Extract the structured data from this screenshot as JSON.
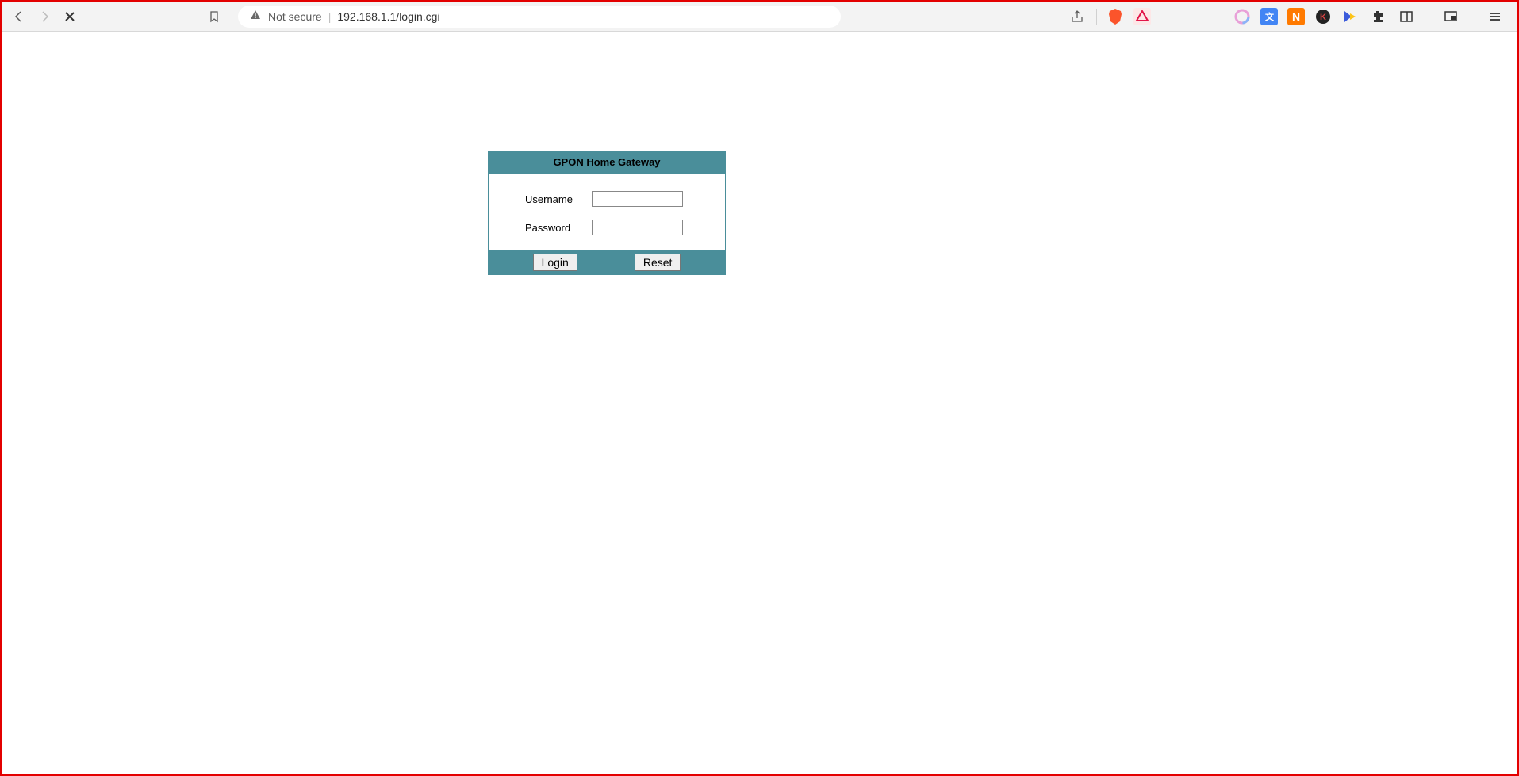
{
  "browser": {
    "security_label": "Not secure",
    "url": "192.168.1.1/login.cgi"
  },
  "login": {
    "title": "GPON Home Gateway",
    "username_label": "Username",
    "password_label": "Password",
    "username_value": "",
    "password_value": "",
    "login_button": "Login",
    "reset_button": "Reset"
  }
}
